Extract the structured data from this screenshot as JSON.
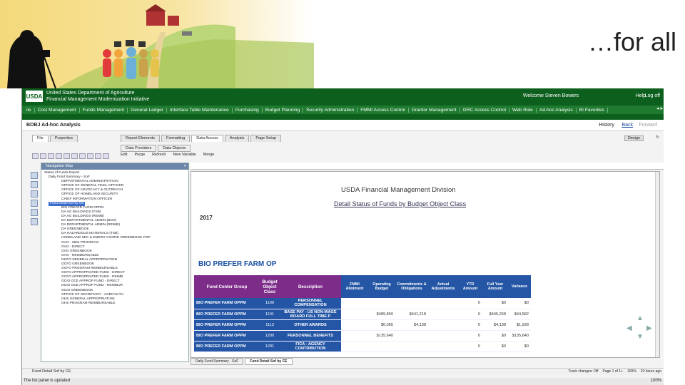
{
  "slide": {
    "title": "…for all"
  },
  "app": {
    "logo": "USDA",
    "org_line1": "United States Department of Agriculture",
    "org_line2": "Financial Management Modernization Initiative",
    "welcome": "Welcome Steven Bowers",
    "help": "Help",
    "logout": "Log off"
  },
  "menu": [
    "ile",
    "Cost Management",
    "Funds Management",
    "General Ledger",
    "Interface Table Maintenance",
    "Purchasing",
    "Budget Planning",
    "Security Administration",
    "FMMI Access Control",
    "Grantor Management",
    "GRC Access Control",
    "Web Role",
    "Ad-hoc Analysis",
    "BI Favorites"
  ],
  "page": {
    "title": "BOBJ Ad-hoc Analysis",
    "history": "History",
    "back": "Back",
    "forward": "Forward"
  },
  "tabs": {
    "left": [
      "File",
      "Properties"
    ],
    "right": [
      "Report Elements",
      "Formatting",
      "Data Access",
      "Analysis",
      "Page Setup"
    ],
    "sub": [
      "Data Providers",
      "Data Objects"
    ],
    "design": "Design",
    "refresh": "Refresh",
    "toolbar2": [
      "Edit",
      "Purge",
      "Refresh",
      "New Variable",
      "Merge"
    ]
  },
  "nav": {
    "header": "Navigation Map",
    "root": "Status of Funds Report",
    "group1": "Daily Fund Summary - SoF",
    "items1": [
      "DEPARTMENTAL ADMINISTRATION",
      "OFFICE OF GENERAL FINCL OFFICER",
      "OFFICE OF ADVOCACY & OUTREACH",
      "OFFICE OF HOMELAND SECURITY",
      "CHIEF INFORMATION OFFICER"
    ],
    "group2": "Fund Detail Sof by CE",
    "items2": [
      "BIO PREFER FARM OPPM",
      "DA AG BUILDINGS (TSB)",
      "DA AG BUILDINGS (REMB)",
      "DA DEPARTMENTAL ADMIN (BOH)",
      "DA DEPARTMENTAL ADMIN (REIMB)",
      "DA GREENBOOK",
      "DA HAZARDOUS MATERIALS (TSB)",
      "HOMELAND SEC & EMERG COORD GREENBOOK POP",
      "OAO - 2501 PROGRAM",
      "OAO - DIRECT",
      "OAO GREENBOOK",
      "OAO - REIMBURSABLE",
      "OCFO GENERAL APPROPRIATION",
      "OCFO GREENBOOK",
      "OCFO PROGRAM REIMBURSABLE",
      "OCFO APPROPRIATED FUND - DIRECT",
      "OCFO APPROPRIATED FUND - REIMB",
      "OCIO OCE APPROP FUND - DIRECT",
      "OCIO OCE APPROP FUND - REIMBUR",
      "OCIO GREENBOOK",
      "OFFICE OF SECRETARY - AGRICULTU",
      "OHS GENERAL APPROPRIATION",
      "OHS PROGRAM REIMBURSABLE"
    ]
  },
  "report": {
    "title": "USDA Financial Management Division",
    "subtitle": "Detail Status of Funds by Budget Object Class",
    "year": "2017",
    "section": "BIO PREFER FARM OP",
    "columns": [
      "Fund Center Group",
      "Budget Object Class",
      "Description",
      "FMMI Allotment",
      "Operating Budget",
      "Commitments & Obligations",
      "Actual Adjustments",
      "YTD Amount",
      "Full Year Amount",
      "Variance"
    ],
    "rows": [
      [
        "BIO PREFER FARM OPPM",
        "1100",
        "PERSONNEL COMPENSATION",
        "",
        "",
        "",
        "",
        "0",
        "$0",
        "$0"
      ],
      [
        "BIO PREFER FARM OPPM",
        "1101",
        "BASE PAY - US NON-WAGE BOARD FULL TIME P",
        "",
        "$489,850",
        "$441,218",
        "",
        "0",
        "$445,268",
        "$44,582"
      ],
      [
        "BIO PREFER FARM OPPM",
        "1113",
        "OTHER AWARDS",
        "",
        "$6,065",
        "$4,138",
        "",
        "0",
        "$4,138",
        "$1,928"
      ],
      [
        "BIO PREFER FARM OPPM",
        "1200",
        "PERSONNEL BENEFITS",
        "",
        "$135,640",
        "",
        "",
        "0",
        "$0",
        "$135,640"
      ],
      [
        "BIO PREFER FARM OPPM",
        "1201",
        "FICA - AGENCY CONTRIBUTION",
        "",
        "",
        "",
        "",
        "0",
        "$0",
        "$0"
      ]
    ]
  },
  "report_tabs": [
    "Daily Fund Summary - SoF",
    "Fund Detail Sof by CE"
  ],
  "status": {
    "left": "Fund Detail Sof by CE",
    "track": "Track changes: Off",
    "page": "Page 1 of 1+",
    "zoom": "100%",
    "ago": "20 hours ago"
  },
  "footer": {
    "left": "The list panel is updated",
    "zoom": "100%"
  }
}
